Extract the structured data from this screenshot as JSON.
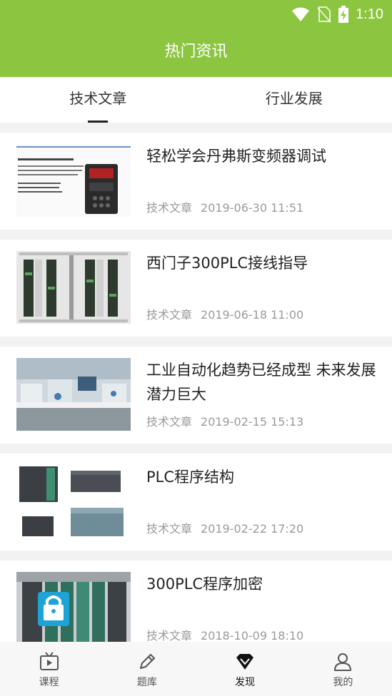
{
  "status_bar": {
    "time": "1:10"
  },
  "header": {
    "title": "热门资讯"
  },
  "tabs": [
    {
      "label": "技术文章",
      "active": true
    },
    {
      "label": "行业发展",
      "active": false
    }
  ],
  "articles": [
    {
      "title": "轻松学会丹弗斯变频器调试",
      "category": "技术文章",
      "date": "2019-06-30 11:51"
    },
    {
      "title": "西门子300PLC接线指导",
      "category": "技术文章",
      "date": "2019-06-18 11:00"
    },
    {
      "title": "工业自动化趋势已经成型 未来发展潜力巨大",
      "category": "技术文章",
      "date": "2019-02-15 15:13"
    },
    {
      "title": "PLC程序结构",
      "category": "技术文章",
      "date": "2019-02-22 17:20"
    },
    {
      "title": "300PLC程序加密",
      "category": "技术文章",
      "date": "2018-10-09 18:10"
    }
  ],
  "bottom_nav": [
    {
      "label": "课程",
      "icon": "tv-play-icon",
      "active": false
    },
    {
      "label": "题库",
      "icon": "pencil-icon",
      "active": false
    },
    {
      "label": "发现",
      "icon": "diamond-icon",
      "active": true
    },
    {
      "label": "我的",
      "icon": "person-icon",
      "active": false
    }
  ],
  "colors": {
    "header": "#8cc540",
    "meta_text": "#9a9a9a"
  }
}
